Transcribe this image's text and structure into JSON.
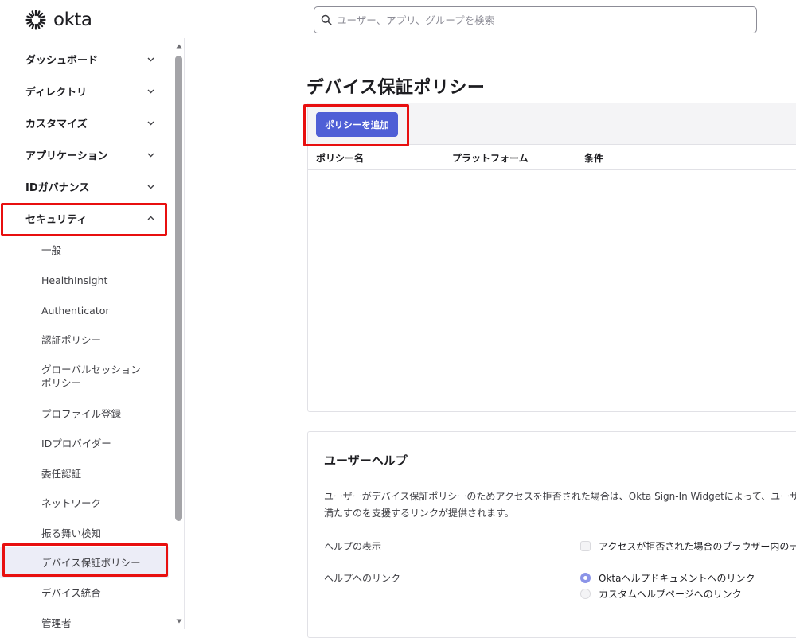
{
  "header": {
    "logo_text": "okta",
    "search_placeholder": "ユーザー、アプリ、グループを検索"
  },
  "sidebar": {
    "items": [
      {
        "label": "ダッシュボード",
        "expanded": false
      },
      {
        "label": "ディレクトリ",
        "expanded": false
      },
      {
        "label": "カスタマイズ",
        "expanded": false
      },
      {
        "label": "アプリケーション",
        "expanded": false
      },
      {
        "label": "IDガバナンス",
        "expanded": false
      },
      {
        "label": "セキュリティ",
        "expanded": true
      }
    ],
    "security_sub_items": [
      {
        "label": "一般"
      },
      {
        "label": "HealthInsight"
      },
      {
        "label": "Authenticator"
      },
      {
        "label": "認証ポリシー"
      },
      {
        "label_line1": "グローバルセッション",
        "label_line2": "ポリシー"
      },
      {
        "label": "プロファイル登録"
      },
      {
        "label": "IDプロバイダー"
      },
      {
        "label": "委任認証"
      },
      {
        "label": "ネットワーク"
      },
      {
        "label": "振る舞い検知"
      },
      {
        "label": "デバイス保証ポリシー",
        "active": true
      },
      {
        "label": "デバイス統合"
      },
      {
        "label": "管理者"
      }
    ]
  },
  "main": {
    "page_title": "デバイス保証ポリシー",
    "add_button_label": "ポリシーを追加",
    "table_columns": [
      "ポリシー名",
      "プラットフォーム",
      "条件"
    ],
    "help": {
      "title": "ユーザーヘルプ",
      "description_line1": "ユーザーがデバイス保証ポリシーのためアクセスを拒否された場合は、Okta Sign-In Widgetによって、ユーザーが",
      "description_line2": "満たすのを支援するリンクが提供されます。",
      "show_help_label": "ヘルプの表示",
      "show_help_option": "アクセスが拒否された場合のブラウザー内のデバ",
      "help_link_label": "ヘルプへのリンク",
      "link_options": [
        {
          "label": "Oktaヘルプドキュメントへのリンク",
          "selected": true
        },
        {
          "label": "カスタムヘルプページへのリンク",
          "selected": false
        }
      ]
    }
  },
  "colors": {
    "accent": "#4f5fd6",
    "highlight_box": "#e80f0f",
    "active_nav_bg": "#ecedf7"
  }
}
